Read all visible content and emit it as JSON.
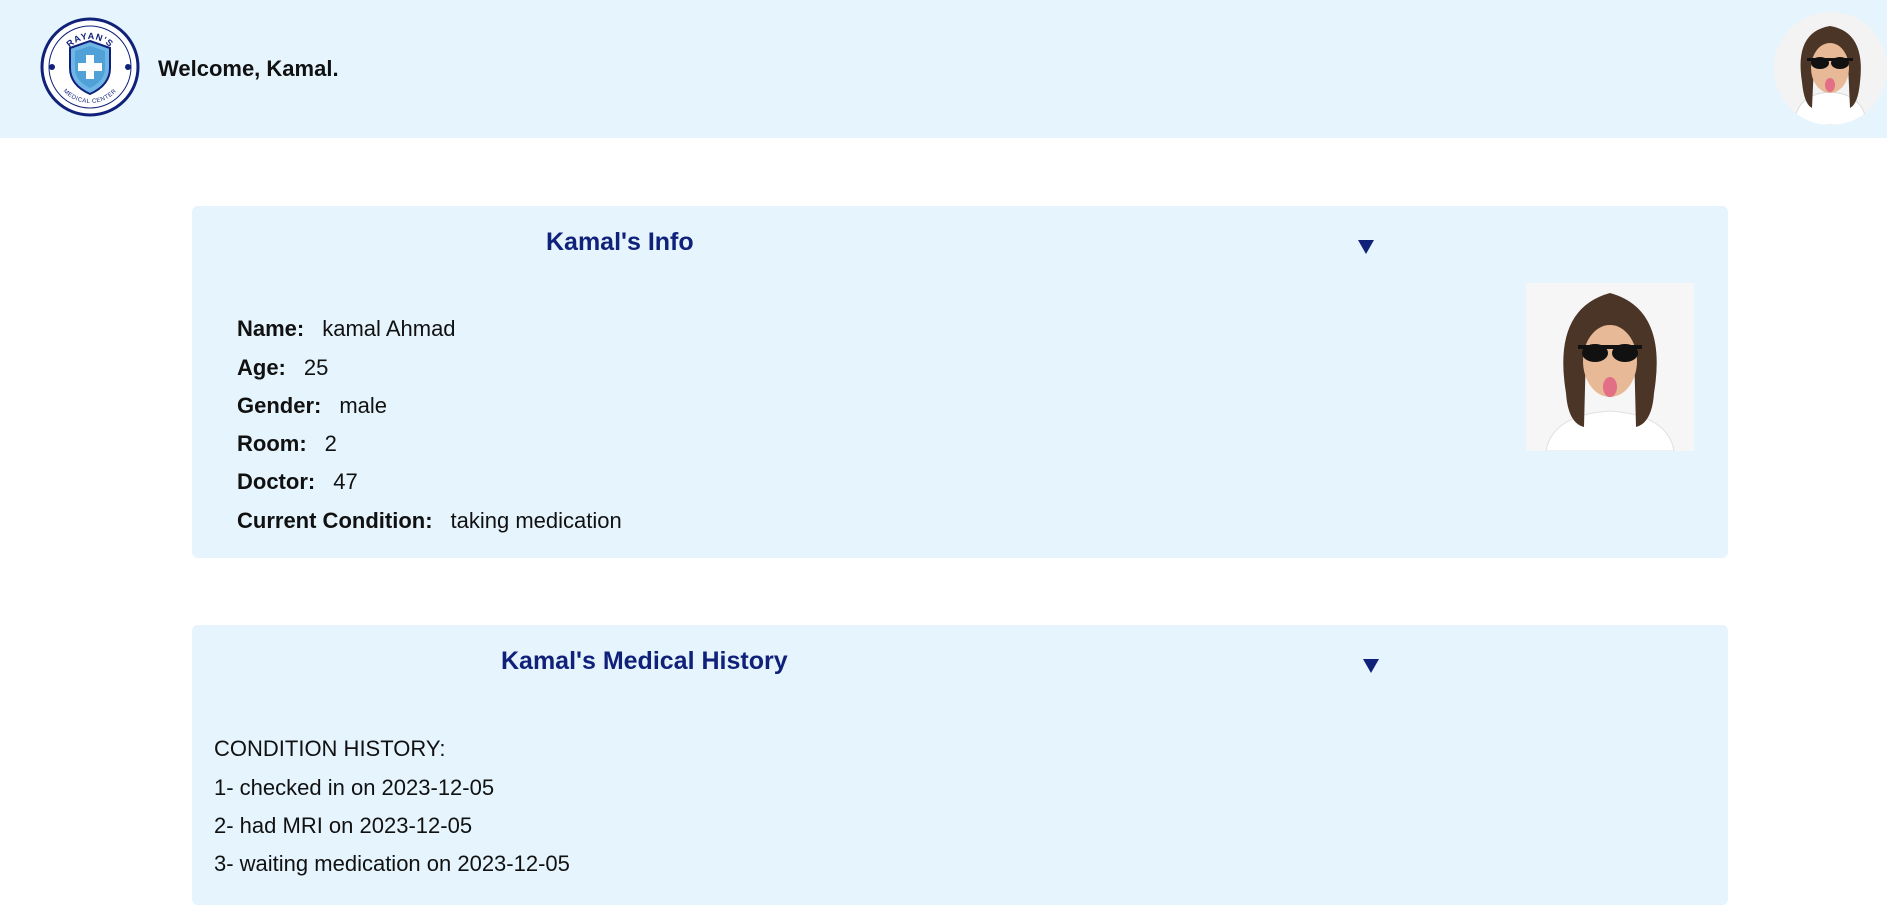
{
  "header": {
    "logo": {
      "top_text": "RAYAN'S",
      "bottom_text": "MEDICAL CENTER",
      "icon": "shield-cross-icon"
    },
    "welcome": "Welcome, Kamal.",
    "avatar_icon": "user-avatar"
  },
  "info_card": {
    "title": "Kamal's Info",
    "toggle_icon": "▼",
    "fields": [
      {
        "label": "Name:",
        "value": "kamal Ahmad"
      },
      {
        "label": "Age:",
        "value": "25"
      },
      {
        "label": "Gender:",
        "value": "male"
      },
      {
        "label": "Room:",
        "value": "2"
      },
      {
        "label": "Doctor:",
        "value": "47"
      },
      {
        "label": "Current Condition:",
        "value": "taking medication"
      }
    ]
  },
  "history_card": {
    "title": "Kamal's Medical History",
    "toggle_icon": "▼",
    "heading": "CONDITION HISTORY:",
    "entries": [
      "1- checked in on 2023-12-05",
      "2- had MRI on 2023-12-05",
      "3- waiting medication on 2023-12-05"
    ]
  },
  "colors": {
    "header_bg": "#e5f4fd",
    "card_bg": "#e5f4fd",
    "title_color": "#10217a"
  }
}
